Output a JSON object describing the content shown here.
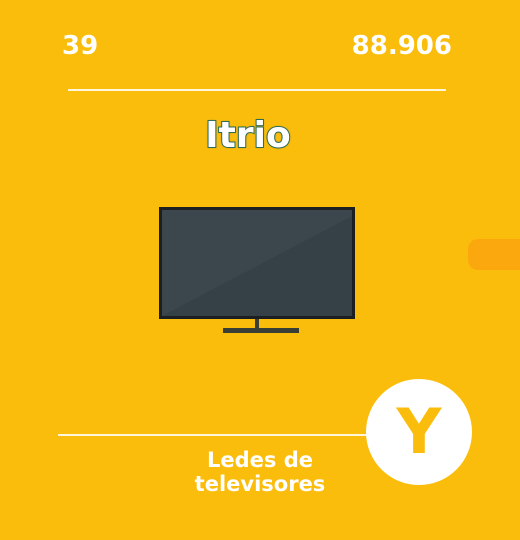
{
  "element": {
    "atomic_number": "39",
    "atomic_mass": "88.906",
    "name": "Itrio",
    "symbol": "Y",
    "usage": "Ledes de televisores"
  },
  "icons": {
    "illustration": "television-icon"
  },
  "colors": {
    "background": "#fbbd0b",
    "tab": "#fba80e",
    "text": "#ffffff",
    "name_outline": "#2f6b55",
    "screen": "#3b474c"
  }
}
